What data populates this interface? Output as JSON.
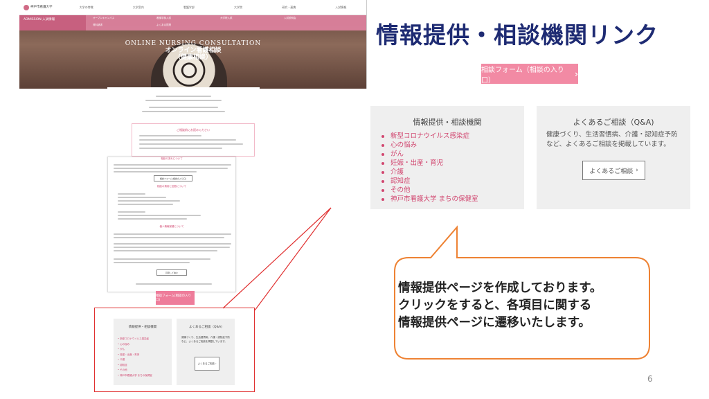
{
  "heading": "情報提供・相談機関リンク",
  "page_number": "6",
  "site": {
    "logo": "神戸市看護大学",
    "nav": [
      "大学の特徴",
      "大学案内",
      "看護学部",
      "大学院",
      "研究・連携",
      "入試情報"
    ],
    "admission": "ADMISSION 入試情報",
    "submenu": [
      "オープンキャンパス",
      "看護学部入試",
      "大学院入試",
      "入試説明会",
      "資料請求",
      "よくある質問"
    ],
    "hero_en": "ONLINE NURSING CONSULTATION",
    "hero_jp": "オンライン看護相談",
    "hero_jp2": "（健康相談）",
    "notice_title": "ご相談前にお読みください",
    "section1": "相談の流れについて",
    "section2": "相談の費用と回答について",
    "section3": "個人情報保護について",
    "apply_small": "相談フォーム(相談の入り口)",
    "apply_button": "相談フォーム(相談の入り口)",
    "detail_btn": "詳細はこちら",
    "agree_btn": "同意して進む"
  },
  "top_button": {
    "label": "相談フォーム（相談の入り口）",
    "chevron": "›"
  },
  "info_card": {
    "title": "情報提供・相談機関",
    "items": [
      "新型コロナウイルス感染症",
      "心の悩み",
      "がん",
      "妊娠・出産・育児",
      "介護",
      "認知症",
      "その他",
      "神戸市看護大学 まちの保健室"
    ]
  },
  "qa_card": {
    "title": "よくあるご相談（Q&A)",
    "description": "健康づくり、生活習慣病、介護・認知症予防など、よくあるご相談を掲載しています。",
    "button": "よくあるご相談",
    "chevron": "›"
  },
  "mini_info_card": {
    "title": "情報提供・相談機関",
    "items": [
      "新型コロナウイルス感染症",
      "心の悩み",
      "がん",
      "妊娠・出産・育児",
      "介護",
      "認知症",
      "その他",
      "神戸市看護大学 まちの保健室"
    ]
  },
  "mini_qa_card": {
    "title": "よくあるご相談（Q&A)",
    "description": "健康づくり、生活習慣病、介護・認知症予防など、よくあるご相談を掲載しています。",
    "button": "よくあるご相談 ›"
  },
  "bubble": {
    "lines": [
      "情報提供ページを作成しております。",
      "クリックをすると、各項目に関する",
      "情報提供ページに遷移いたします。"
    ]
  },
  "colors": {
    "heading": "#1e2b73",
    "pink_button": "#f28aa4",
    "link_pink": "#d1466f",
    "bubble_border": "#ee8233",
    "highlight_red": "#e03030"
  }
}
